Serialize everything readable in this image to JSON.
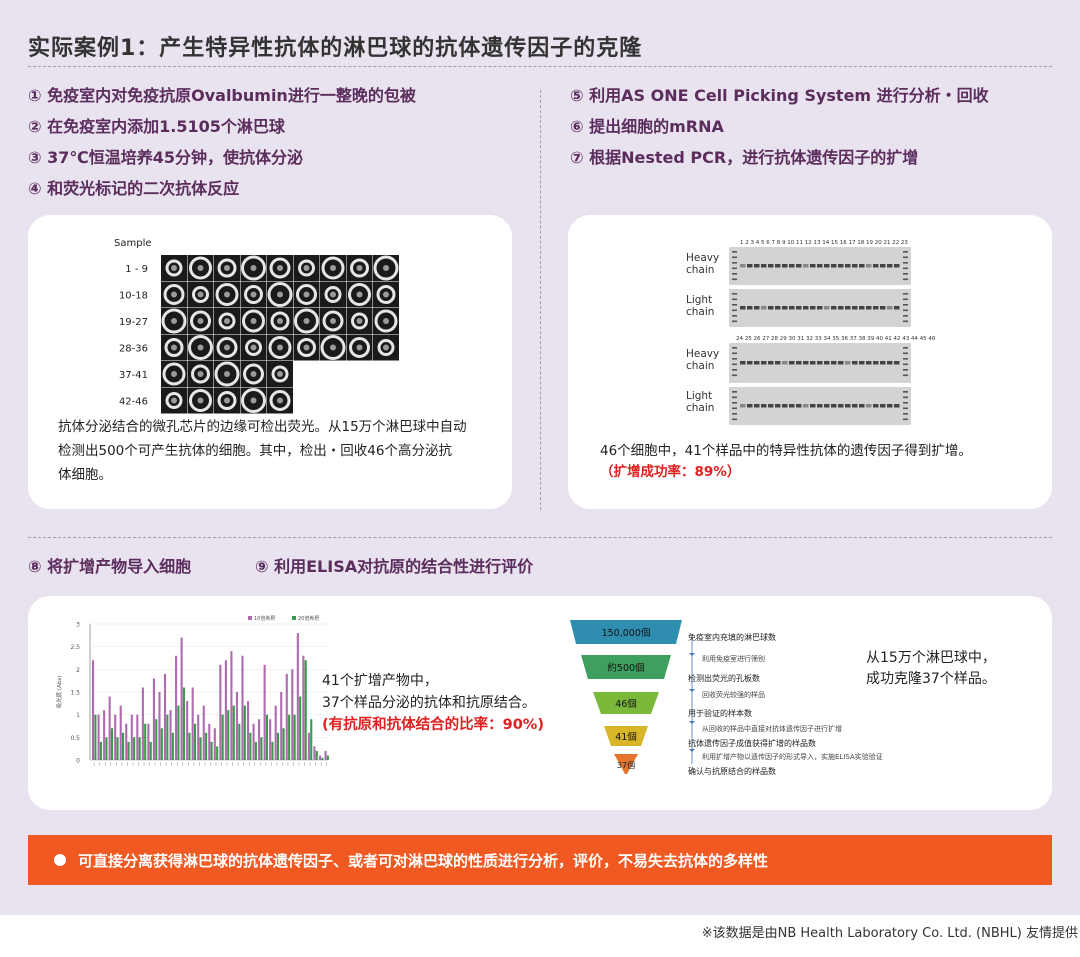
{
  "title": "实际案例1：产生特异性抗体的淋巴球的抗体遗传因子的克隆",
  "steps_left": [
    "① 免疫室内对免疫抗原Ovalbumin进行一整晚的包被",
    "② 在免疫室内添加1.5105个淋巴球",
    "③ 37℃恒温培养45分钟，使抗体分泌",
    "④ 和荧光标记的二次抗体反应"
  ],
  "steps_right": [
    "⑤ 利用AS ONE Cell Picking System 进行分析・回收",
    "⑥ 提出细胞的mRNA",
    "⑦ 根据Nested PCR，进行抗体遗传因子的扩增"
  ],
  "microarray": {
    "header": "Sample",
    "rows": [
      {
        "label": "1 - 9",
        "count": 9
      },
      {
        "label": "10-18",
        "count": 9
      },
      {
        "label": "19-27",
        "count": 9
      },
      {
        "label": "28-36",
        "count": 9
      },
      {
        "label": "37-41",
        "count": 5
      },
      {
        "label": "42-46",
        "count": 5
      }
    ]
  },
  "card1_caption": [
    "抗体分泌结合的微孔芯片的边缘可检出荧光。从15万个淋巴球中自动",
    "检测出500个可产生抗体的细胞。其中，检出・回收46个高分泌抗",
    "体细胞。"
  ],
  "gel": {
    "top_lane_numbers": "1  2  3  4  5  6  7  8  9 10 11 12 13 14 15 16 17 18 19 20 21 22 23",
    "bottom_lane_numbers": "24 25 26 27 28 29 30 31 32 33 34 35 36 37 38 39 40 41 42 43 44 45 46",
    "labels": [
      "Heavy\nchain",
      "Light\nchain",
      "Heavy\nchain",
      "Light\nchain"
    ],
    "label_lines": [
      [
        "Heavy",
        "chain"
      ],
      [
        "Light",
        "chain"
      ],
      [
        "Heavy",
        "chain"
      ],
      [
        "Light",
        "chain"
      ]
    ]
  },
  "card2_caption": "46个细胞中，41个样品中的特异性抗体的遗传因子得到扩增。",
  "card2_highlight": "（扩增成功率：89%）",
  "steps_bottom": [
    "⑧ 将扩增产物导入细胞",
    "⑨ 利用ELISA对抗原的结合性进行评价"
  ],
  "chart_data": {
    "type": "bar",
    "legend": [
      "10倍希釈",
      "20倍希釈"
    ],
    "legend_placement": "top-right",
    "ylabel": "吸光度 (Abs)",
    "ylim": [
      0,
      3
    ],
    "yticks": [
      "3",
      "2.5",
      "2",
      "1.5",
      "1",
      "0.5",
      "0"
    ],
    "colors": [
      "#b06ab0",
      "#3a9a4a"
    ],
    "series": [
      {
        "name": "10倍希釈",
        "values": [
          2.2,
          1.0,
          1.1,
          1.4,
          1.0,
          1.2,
          0.8,
          1.0,
          1.0,
          1.6,
          0.8,
          1.8,
          1.5,
          1.9,
          1.1,
          2.3,
          2.7,
          1.3,
          1.6,
          1.0,
          1.2,
          0.8,
          0.7,
          2.1,
          2.2,
          2.4,
          1.5,
          2.3,
          1.3,
          0.8,
          0.9,
          2.1,
          0.9,
          1.2,
          1.5,
          1.9,
          2.0,
          2.8,
          2.3,
          0.6,
          0.3,
          0.1,
          0.2
        ]
      },
      {
        "name": "20倍希釈",
        "values": [
          1.0,
          0.4,
          0.5,
          0.7,
          0.5,
          0.6,
          0.4,
          0.5,
          0.5,
          0.8,
          0.4,
          0.9,
          0.7,
          1.0,
          0.6,
          1.2,
          1.6,
          0.6,
          0.8,
          0.5,
          0.6,
          0.4,
          0.3,
          1.0,
          1.1,
          1.2,
          0.8,
          1.2,
          0.6,
          0.4,
          0.5,
          1.0,
          0.4,
          0.6,
          0.7,
          1.0,
          1.0,
          1.4,
          2.2,
          0.9,
          0.2,
          0.05,
          0.1
        ]
      }
    ]
  },
  "card3_caption": [
    "41个扩增产物中，",
    "37个样品分泌的抗体和抗原结合。"
  ],
  "card3_highlight": "(有抗原和抗体结合的比率：90%)",
  "funnel": {
    "levels": [
      {
        "label": "150,000個",
        "color": "#2f8eb0"
      },
      {
        "label": "約500個",
        "color": "#3f9f5f"
      },
      {
        "label": "46個",
        "color": "#7ab93a"
      },
      {
        "label": "41個",
        "color": "#d8b628"
      },
      {
        "label": "37個",
        "color": "#e4742c"
      }
    ],
    "descriptions": [
      "免疫室内充填的淋巴球数",
      "检测出荧光的孔板数",
      "用于验证的样本数",
      "抗体遗传因子成值获得扩增的样品数",
      "确认与抗原结合的样品数"
    ],
    "arrows": [
      "利用免疫室进行筛别",
      "回收荧光较强的样品",
      "从回收的样品中直接对抗体遗传因子进行扩增",
      "利用扩增产物以遗传因子的形式导入，实施ELISA实验验证"
    ]
  },
  "card4_caption": [
    "从15万个淋巴球中，",
    "成功克隆37个样品。"
  ],
  "banner": "可直接分离获得淋巴球的抗体遗传因子、或者可对淋巴球的性质进行分析，评价，不易失去抗体的多样性",
  "credit": "※该数据是由NB Health Laboratory Co. Ltd. (NBHL) 友情提供"
}
